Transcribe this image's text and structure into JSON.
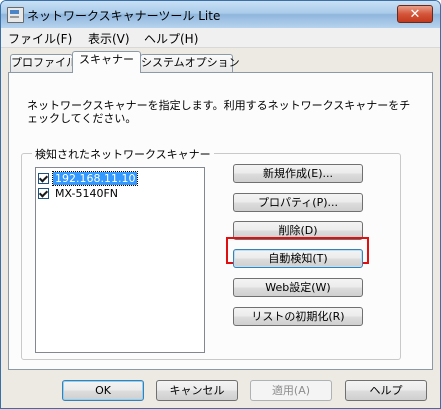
{
  "window": {
    "title": "ネットワークスキャナーツール Lite",
    "close_glyph": "✕"
  },
  "menu": {
    "items": [
      "ファイル(F)",
      "表示(V)",
      "ヘルプ(H)"
    ]
  },
  "tabs": [
    {
      "label": "プロファイル",
      "active": false
    },
    {
      "label": "スキャナー",
      "active": true
    },
    {
      "label": "システムオプション",
      "active": false
    }
  ],
  "panel": {
    "description": "ネットワークスキャナーを指定します。利用するネットワークスキャナーをチェックしてください。",
    "group_title": "検知されたネットワークスキャナー",
    "scanners": [
      {
        "name": "192.168.11.10",
        "checked": true,
        "selected": true
      },
      {
        "name": "MX-5140FN",
        "checked": true,
        "selected": false
      }
    ],
    "buttons": {
      "new": "新規作成(E)...",
      "properties": "プロパティ(P)...",
      "delete": "削除(D)",
      "auto_detect": "自動検知(T)",
      "web_settings": "Web設定(W)",
      "reset_list": "リストの初期化(R)"
    }
  },
  "footer": {
    "ok": "OK",
    "cancel": "キャンセル",
    "apply": "適用(A)",
    "help": "ヘルプ"
  },
  "colors": {
    "highlight_box": "#e01010",
    "selection": "#3399ff"
  }
}
